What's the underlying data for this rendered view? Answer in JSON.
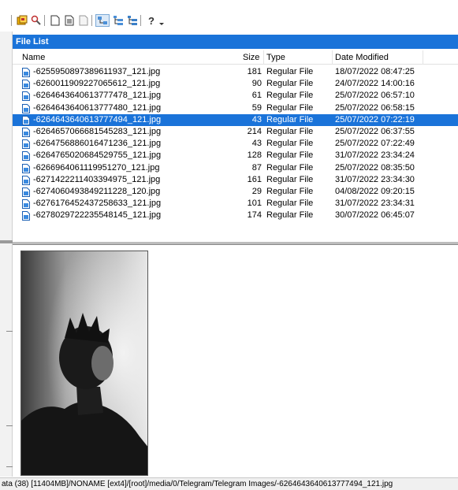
{
  "toolbar": {
    "buttons": [
      {
        "icon": "gallery-icon"
      },
      {
        "icon": "search-icon"
      },
      {
        "icon": "new-document-icon"
      },
      {
        "icon": "document-icon"
      },
      {
        "icon": "blank-document-icon"
      },
      {
        "icon": "link-view-icon"
      },
      {
        "icon": "tree-view-icon"
      },
      {
        "icon": "tree-expand-icon"
      },
      {
        "icon": "help-icon"
      },
      {
        "icon": "dropdown-arrow-icon"
      }
    ]
  },
  "file_list": {
    "title": "File List",
    "columns": {
      "name": "Name",
      "size": "Size",
      "type": "Type",
      "date": "Date Modified"
    },
    "rows": [
      {
        "name": "-6255950897389611937_121.jpg",
        "size": "181",
        "type": "Regular File",
        "date": "18/07/2022 08:47:25",
        "selected": false
      },
      {
        "name": "-6260011909227065612_121.jpg",
        "size": "90",
        "type": "Regular File",
        "date": "24/07/2022 14:00:16",
        "selected": false
      },
      {
        "name": "-6264643640613777478_121.jpg",
        "size": "61",
        "type": "Regular File",
        "date": "25/07/2022 06:57:10",
        "selected": false
      },
      {
        "name": "-6264643640613777480_121.jpg",
        "size": "59",
        "type": "Regular File",
        "date": "25/07/2022 06:58:15",
        "selected": false
      },
      {
        "name": "-6264643640613777494_121.jpg",
        "size": "43",
        "type": "Regular File",
        "date": "25/07/2022 07:22:19",
        "selected": true
      },
      {
        "name": "-6264657066681545283_121.jpg",
        "size": "214",
        "type": "Regular File",
        "date": "25/07/2022 06:37:55",
        "selected": false
      },
      {
        "name": "-6264756886016471236_121.jpg",
        "size": "43",
        "type": "Regular File",
        "date": "25/07/2022 07:22:49",
        "selected": false
      },
      {
        "name": "-6264765020684529755_121.jpg",
        "size": "128",
        "type": "Regular File",
        "date": "31/07/2022 23:34:24",
        "selected": false
      },
      {
        "name": "-6266964061119951270_121.jpg",
        "size": "87",
        "type": "Regular File",
        "date": "25/07/2022 08:35:50",
        "selected": false
      },
      {
        "name": "-6271422211403394975_121.jpg",
        "size": "161",
        "type": "Regular File",
        "date": "31/07/2022 23:34:30",
        "selected": false
      },
      {
        "name": "-6274060493849211228_120.jpg",
        "size": "29",
        "type": "Regular File",
        "date": "04/08/2022 09:20:15",
        "selected": false
      },
      {
        "name": "-6276176452437258633_121.jpg",
        "size": "101",
        "type": "Regular File",
        "date": "31/07/2022 23:34:31",
        "selected": false
      },
      {
        "name": "-6278029722235548145_121.jpg",
        "size": "174",
        "type": "Regular File",
        "date": "30/07/2022 06:45:07",
        "selected": false
      }
    ]
  },
  "status": {
    "path": "ata (38) [11404MB]/NONAME [ext4]/[root]/media/0/Telegram/Telegram Images/-6264643640613777494_121.jpg"
  }
}
